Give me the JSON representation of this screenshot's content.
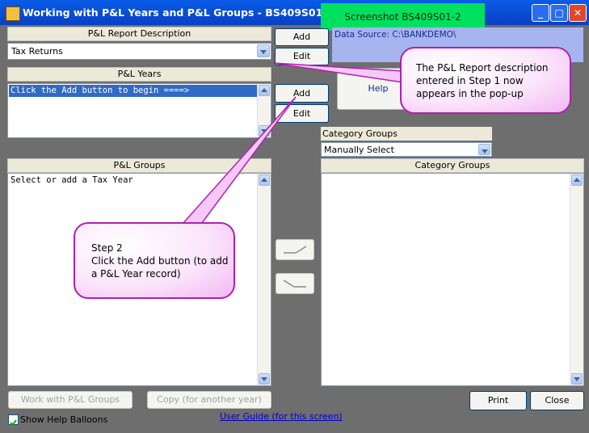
{
  "window": {
    "title": "Working with P&L Years and P&L Groups - BS409S01   Prog",
    "minimize_icon": "minimize-icon",
    "maximize_icon": "maximize-icon",
    "close_icon": "close-icon"
  },
  "screenshot_label": "Screenshot BS409S01-2",
  "report": {
    "header": "P&L Report Description",
    "selected": "Tax Returns",
    "add_label": "Add",
    "edit_label": "Edit"
  },
  "data_source": "Data Source: C:\\BANKDEMO\\",
  "help_label": "Help",
  "years": {
    "header": "P&L Years",
    "items": [
      "Click the Add button to begin ====>"
    ],
    "add_label": "Add",
    "edit_label": "Edit"
  },
  "groups": {
    "header": "P&L Groups",
    "placeholder_text": "Select or add a Tax Year"
  },
  "category_groups": {
    "label": "Category Groups",
    "selected": "Manually Select",
    "list_header": "Category Groups"
  },
  "balloons": {
    "step1": "The P&L Report description entered in Step 1 now appears in the pop-up",
    "step2_title": "Step 2",
    "step2_body": "Click the Add button (to add a P&L Year record)"
  },
  "footer": {
    "work_with_groups": "Work with P&L Groups",
    "copy": "Copy (for another year)",
    "print": "Print",
    "close": "Close",
    "show_help": "Show Help Balloons",
    "show_help_checked": true,
    "user_guide": "User Guide (for this screen)"
  },
  "colors": {
    "title_bar": "#0a5ce8",
    "panel": "#6e6e6e",
    "selection": "#316ac5",
    "balloon_border": "#b020b0",
    "green_label": "#00e060",
    "data_source_bg": "#a6b4f0"
  }
}
